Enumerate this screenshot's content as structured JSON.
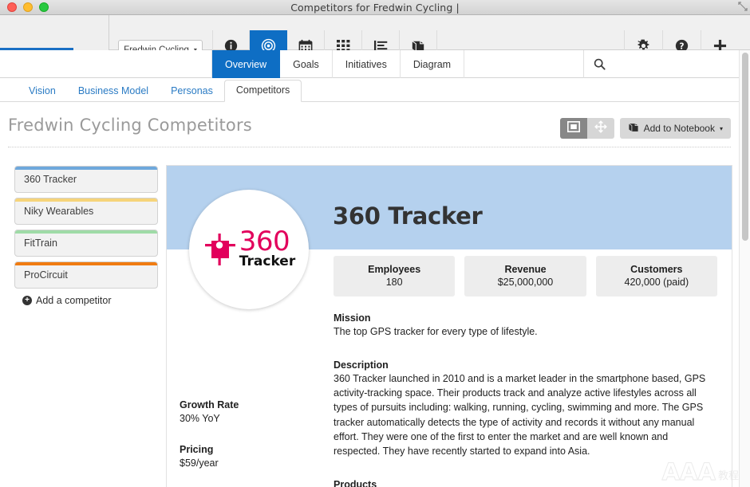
{
  "window": {
    "title": "Competitors for Fredwin Cycling |",
    "controls": {
      "close": "close-button",
      "minimize": "minimize-button",
      "maximize": "maximize-button"
    }
  },
  "chrome": {
    "org_selector": {
      "label": "Fredwin Cycling",
      "caret": "▾"
    },
    "nav_icons": [
      {
        "name": "info-icon",
        "glyph": "info"
      },
      {
        "name": "target-icon",
        "glyph": "target",
        "active": true
      },
      {
        "name": "calendar-icon",
        "glyph": "calendar"
      },
      {
        "name": "grid-icon",
        "glyph": "grid"
      },
      {
        "name": "list-icon",
        "glyph": "list"
      },
      {
        "name": "book-icon",
        "glyph": "book"
      }
    ],
    "right_icons": [
      {
        "name": "settings-gear-icon",
        "glyph": "gear"
      },
      {
        "name": "help-icon",
        "glyph": "question"
      },
      {
        "name": "add-icon",
        "glyph": "plus"
      }
    ]
  },
  "primary_tabs": [
    {
      "label": "Overview",
      "active": true
    },
    {
      "label": "Goals",
      "active": false
    },
    {
      "label": "Initiatives",
      "active": false
    },
    {
      "label": "Diagram",
      "active": false
    }
  ],
  "search": {
    "placeholder": "",
    "value": "",
    "icon": "search-icon"
  },
  "sub_tabs": [
    {
      "label": "Vision",
      "active": false
    },
    {
      "label": "Business Model",
      "active": false
    },
    {
      "label": "Personas",
      "active": false
    },
    {
      "label": "Competitors",
      "active": true
    }
  ],
  "page": {
    "title": "Fredwin Cycling Competitors",
    "actions": {
      "view_panel_label": "panel-view",
      "view_grid_label": "expand-view",
      "notebook_label": "Add to Notebook",
      "notebook_caret": "▾"
    }
  },
  "competitors": [
    {
      "name": "360 Tracker",
      "color": "#6fa8dc",
      "selected": true
    },
    {
      "name": "Niky Wearables",
      "color": "#f6d47a",
      "selected": false
    },
    {
      "name": "FitTrain",
      "color": "#9fdba7",
      "selected": false
    },
    {
      "name": "ProCircuit",
      "color": "#f07c12",
      "selected": false
    }
  ],
  "add_competitor": {
    "label": "Add a competitor",
    "icon": "plus-circle-icon"
  },
  "detail": {
    "company_name": "360 Tracker",
    "logo": {
      "word_360": "360",
      "word_tracker": "Tracker",
      "color": "#e2005c"
    },
    "hero_color": "#b5d1ee",
    "stats": [
      {
        "label": "Employees",
        "value": "180"
      },
      {
        "label": "Revenue",
        "value": "$25,000,000"
      },
      {
        "label": "Customers",
        "value": "420,000 (paid)"
      }
    ],
    "side_fields": [
      {
        "label": "Growth Rate",
        "value": "30% YoY"
      },
      {
        "label": "Pricing",
        "value": "$59/year"
      }
    ],
    "sections": [
      {
        "title": "Mission",
        "text": "The top GPS tracker for every type of lifestyle."
      },
      {
        "title": "Description",
        "text": "360 Tracker launched in 2010 and is a market leader in the smartphone based, GPS activity-tracking space. Their products track and analyze active lifestyles across all types of pursuits including: walking, running, cycling, swimming and more. The GPS tracker automatically detects the type of activity and records it without any manual effort. They were one of the first to enter the market and are well known and respected. They have recently started to expand into Asia."
      },
      {
        "title": "Products",
        "text": ""
      }
    ]
  },
  "watermark": {
    "main": "AAA",
    "sub": "教程"
  }
}
